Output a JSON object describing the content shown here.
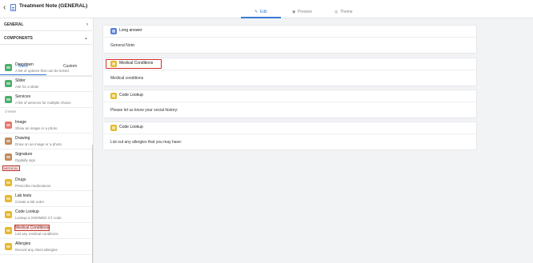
{
  "header": {
    "title": "Treatment Note (GENERAL)",
    "tabs": [
      {
        "label": "Edit",
        "icon": "pencil-icon"
      },
      {
        "label": "Preview",
        "icon": "eye-icon"
      },
      {
        "label": "Theme",
        "icon": "palette-icon"
      }
    ]
  },
  "sidebar": {
    "sections": {
      "general": "GENERAL",
      "components": "COMPONENTS"
    },
    "subtabs": {
      "basic": "Basic",
      "custom": "Custom"
    },
    "categories": {
      "other": "OTHER",
      "medical": "MEDICAL"
    },
    "items": [
      {
        "name": "Dropdown",
        "desc": "A list of options that can be ticked",
        "color": "#4cae6e"
      },
      {
        "name": "Slider",
        "desc": "Ask for a slider",
        "color": "#4cae6e"
      },
      {
        "name": "Services",
        "desc": "A list of services for multiple choice",
        "color": "#4cae6e"
      },
      {
        "name": "Image",
        "desc": "Show an image or a photo",
        "color": "#e8766a"
      },
      {
        "name": "Drawing",
        "desc": "Draw on an image or a photo",
        "color": "#c28a5a"
      },
      {
        "name": "Signature",
        "desc": "Digitally sign",
        "color": "#c28a5a"
      },
      {
        "name": "Drugs",
        "desc": "Prescribe medications",
        "color": "#e3b92e"
      },
      {
        "name": "Lab tests",
        "desc": "Create a lab order",
        "color": "#e3b92e"
      },
      {
        "name": "Code Lookup",
        "desc": "Lookup a SNOMED CT code",
        "color": "#e3b92e"
      },
      {
        "name": "Medical Conditions",
        "desc": "List any medical conditions",
        "color": "#e3b92e"
      },
      {
        "name": "Allergies",
        "desc": "Record any client allergies",
        "color": "#e3b92e"
      }
    ]
  },
  "canvas": {
    "cards": [
      {
        "label": "Long answer",
        "question": "General Note:",
        "color": "#5b7fd6"
      },
      {
        "label": "Medical Conditions",
        "question": "Medical conditions",
        "color": "#e3b92e"
      },
      {
        "label": "Code Lookup",
        "question": "Please let us know your social history:",
        "color": "#e3b92e"
      },
      {
        "label": "Code Lookup",
        "question": "List out any allergies that you may have:",
        "color": "#e3b92e"
      }
    ]
  }
}
